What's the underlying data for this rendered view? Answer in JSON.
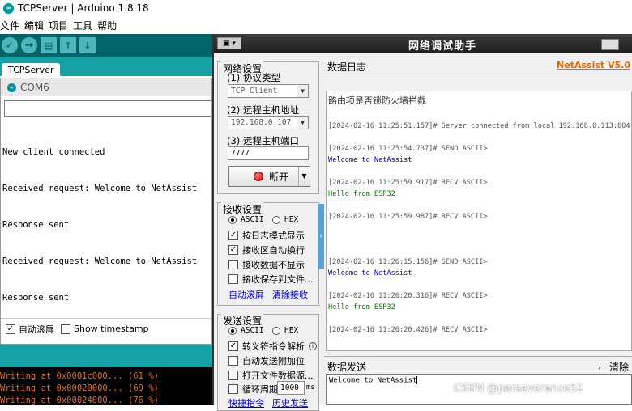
{
  "arduino": {
    "title": "TCPServer | Arduino 1.8.18",
    "logo": "∞",
    "menu": [
      "文件",
      "编辑",
      "项目",
      "工具",
      "帮助"
    ],
    "toolbar_icons": [
      "verify-icon",
      "upload-icon",
      "new-icon",
      "open-icon",
      "save-icon"
    ],
    "tab": "TCPServer",
    "console_lines": [
      "Writing at 0x0001c000... (61 %)",
      "Writing at 0x00020000... (69 %)",
      "Writing at 0x00024000... (76 %)"
    ]
  },
  "serial_monitor": {
    "title": "COM6",
    "lines": [
      "New client connected",
      "Received request: Welcome to NetAssist",
      "Response sent",
      "Received request: Welcome to NetAssist",
      "Response sent"
    ],
    "autoscroll_label": "自动滚屏",
    "autoscroll_checked": true,
    "timestamp_label": "Show timestamp",
    "timestamp_checked": false
  },
  "netassist": {
    "title": "网络调试助手",
    "brand": "NetAssist V5.0",
    "net_settings": {
      "title": "网络设置",
      "protocol_label": "(1) 协议类型",
      "protocol_value": "TCP Client",
      "host_label": "(2) 远程主机地址",
      "host_value": "192.168.0.107",
      "port_label": "(3) 远程主机端口",
      "port_value": "7777",
      "connect_button": "断开"
    },
    "recv_settings": {
      "title": "接收设置",
      "ascii": "ASCII",
      "hex": "HEX",
      "options": [
        {
          "label": "按日志模式显示",
          "checked": true
        },
        {
          "label": "接收区自动换行",
          "checked": true
        },
        {
          "label": "接收数据不显示",
          "checked": false
        },
        {
          "label": "接收保存到文件...",
          "checked": false
        }
      ],
      "link_autoscroll": "自动滚屏",
      "link_clear": "清除接收"
    },
    "send_settings": {
      "title": "发送设置",
      "ascii": "ASCII",
      "hex": "HEX",
      "options": [
        {
          "label": "转义符指令解析",
          "checked": true
        },
        {
          "label": "自动发送附加位",
          "checked": false
        },
        {
          "label": "打开文件数据源...",
          "checked": false
        },
        {
          "label": "循环周期",
          "checked": false
        }
      ],
      "period_value": "1000",
      "period_unit": "ms",
      "link_shortcut": "快捷指令",
      "link_history": "历史发送"
    },
    "recv_tab": "数据日志",
    "firewall_note": "路由项是否锁防火墙拦截",
    "log": [
      {
        "text": "[2024-02-16 11:25:51.157]# Server connected from local 192.168.0.113:604",
        "kind": "meta"
      },
      {
        "text": "[2024-02-16 11:25:54.737]# SEND ASCII>",
        "kind": "meta"
      },
      {
        "text": "Welcome to NetAssist",
        "kind": "send"
      },
      {
        "text": "[2024-02-16 11:25:59.917]# RECV ASCII>",
        "kind": "meta"
      },
      {
        "text": "Hello from ESP32",
        "kind": "recv"
      },
      {
        "text": "[2024-02-16 11:25:59.987]# RECV ASCII>",
        "kind": "meta"
      },
      {
        "text": "[2024-02-16 11:26:15.156]# SEND ASCII>",
        "kind": "meta"
      },
      {
        "text": "Welcome to NetAssist",
        "kind": "send"
      },
      {
        "text": "[2024-02-16 11:26:20.316]# RECV ASCII>",
        "kind": "meta"
      },
      {
        "text": "Hello from ESP32",
        "kind": "recv"
      },
      {
        "text": "[2024-02-16 11:26:20.426]# RECV ASCII>",
        "kind": "meta"
      }
    ],
    "send_tab": "数据发送",
    "clear_button": "清除",
    "send_text": "Welcome to NetAssist"
  },
  "watermark": "CSDN @perseverance52"
}
